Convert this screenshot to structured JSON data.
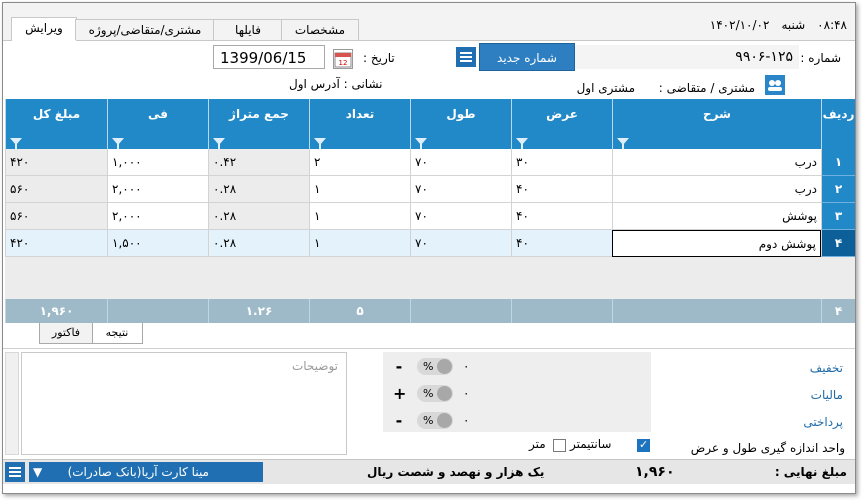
{
  "clock": {
    "time": "۰۸:۴۸",
    "day": "شنبه",
    "date": "۱۴۰۲/۱۰/۰۲"
  },
  "tabs": [
    "ویرایش",
    "مشتری/متقاضی/پروژه",
    "فایلها",
    "مشخصات"
  ],
  "header": {
    "number_label": "شماره :",
    "number_value": "۹۹۰۶-۱۲۵",
    "new_number_button": "شماره جدید",
    "date_label": "تاریخ :",
    "date_value": "1399/06/15",
    "customer_label": "مشتری / متقاضی :",
    "customer_value": "مشتری اول",
    "address_label": "نشانی : آدرس اول"
  },
  "grid": {
    "columns": [
      "ردیف",
      "شرح",
      "عرض",
      "طول",
      "تعداد",
      "جمع متراژ",
      "فی",
      "مبلغ کل"
    ],
    "rows": [
      {
        "row": "۱",
        "desc": "درب",
        "width": "۳۰",
        "length": "۷۰",
        "count": "۲",
        "area": "۰.۴۲",
        "price": "۱,۰۰۰",
        "total": "۴۲۰"
      },
      {
        "row": "۲",
        "desc": "درب",
        "width": "۴۰",
        "length": "۷۰",
        "count": "۱",
        "area": "۰.۲۸",
        "price": "۲,۰۰۰",
        "total": "۵۶۰"
      },
      {
        "row": "۳",
        "desc": "پوشش",
        "width": "۴۰",
        "length": "۷۰",
        "count": "۱",
        "area": "۰.۲۸",
        "price": "۲,۰۰۰",
        "total": "۵۶۰"
      },
      {
        "row": "۴",
        "desc": "پوشش دوم",
        "width": "۴۰",
        "length": "۷۰",
        "count": "۱",
        "area": "۰.۲۸",
        "price": "۱,۵۰۰",
        "total": "۴۲۰"
      }
    ],
    "footer": {
      "row_count": "۴",
      "count_sum": "۵",
      "area_sum": "۱.۲۶",
      "total_sum": "۱,۹۶۰"
    }
  },
  "bottom_tabs": [
    "نتیجه",
    "فاکتور"
  ],
  "notes_placeholder": "توضیحات",
  "adjustments": [
    {
      "label": "تخفیف",
      "sign": "-",
      "unit": "%",
      "value": "۰"
    },
    {
      "label": "مالیات",
      "sign": "+",
      "unit": "%",
      "value": "۰"
    },
    {
      "label": "پرداختی",
      "sign": "-",
      "unit": "%",
      "value": "۰"
    }
  ],
  "units": {
    "label": "واحد اندازه گیری طول و عرض",
    "centimeter": "سانتیمتر",
    "centimeter_checked": true,
    "meter": "متر",
    "meter_checked": false
  },
  "status": {
    "final_label": "مبلغ نهایی :",
    "final_value": "۱,۹۶۰",
    "final_words": "یک هزار و نهصد و شصت ریال",
    "bank": "مینا کارت آریا(بانک صادرات)"
  }
}
